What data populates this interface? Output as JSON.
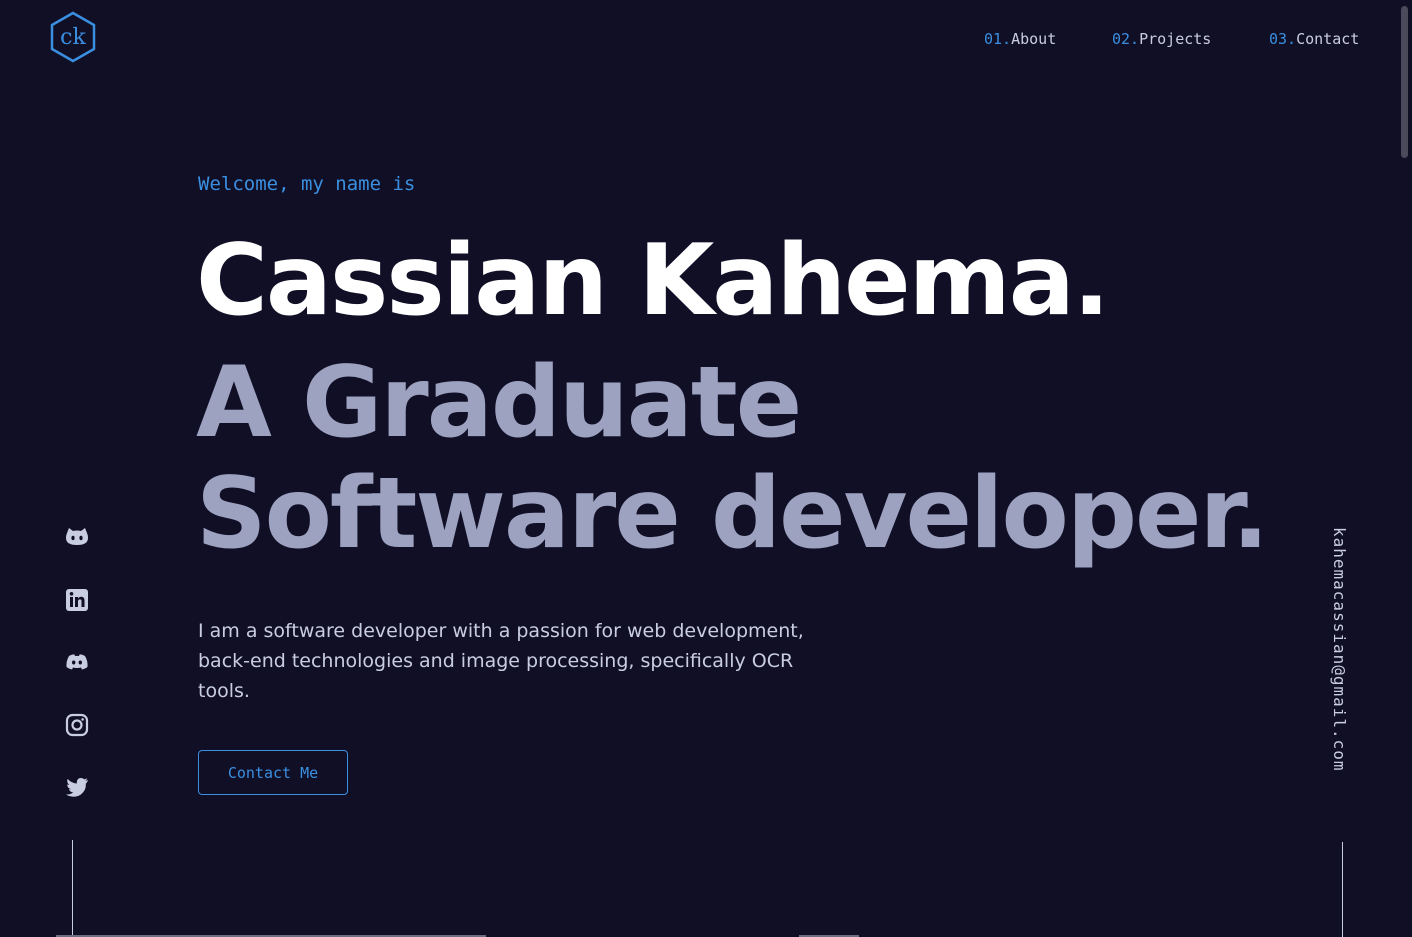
{
  "header": {
    "logo_icon": "ck-hexagon-logo",
    "nav": [
      {
        "num": "01.",
        "label": "About"
      },
      {
        "num": "02.",
        "label": "Projects"
      },
      {
        "num": "03.",
        "label": "Contact"
      }
    ]
  },
  "hero": {
    "intro": "Welcome, my name is",
    "name": "Cassian Kahema.",
    "tagline": "A Graduate Software developer.",
    "bio": "I am a software developer with a passion for web development, back-end technologies and image processing, specifically OCR tools.",
    "cta_label": "Contact Me"
  },
  "social": {
    "icons": [
      "github-icon",
      "linkedin-icon",
      "discord-icon",
      "instagram-icon",
      "twitter-icon"
    ]
  },
  "email": "kahemacassian@gmail.com",
  "colors": {
    "background": "#110f26",
    "accent": "#3a8fe0",
    "muted": "#9da2c0",
    "text": "#c9cde0"
  }
}
